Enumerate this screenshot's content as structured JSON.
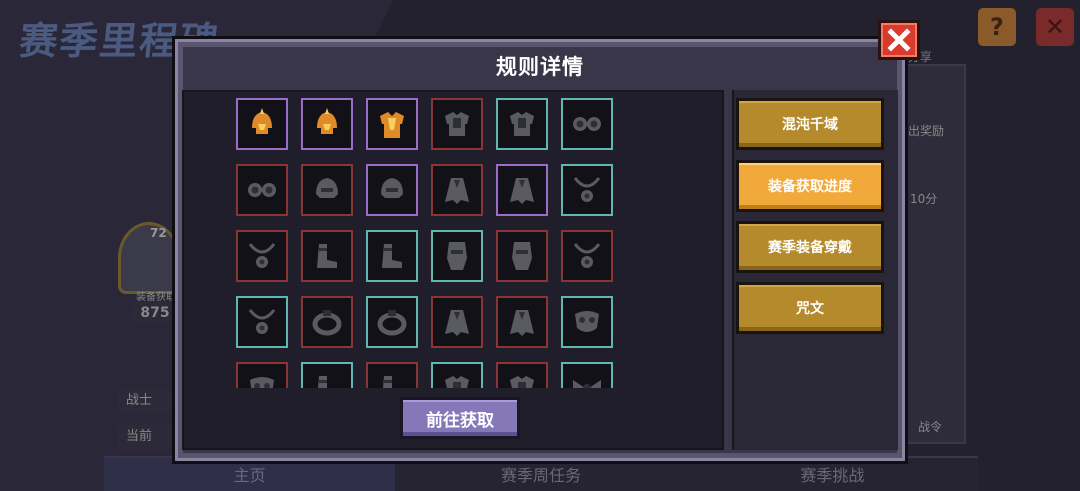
{
  "background": {
    "title": "赛季里程碑",
    "share_label": "分享",
    "side_texts": [
      "出奖励",
      "10分",
      "战令"
    ],
    "left_badge_pct": "72",
    "left_badge_label": "装备获取",
    "left_number": "875",
    "left_rows": [
      "战士",
      "当前"
    ],
    "bottom_tabs": [
      "主页",
      "赛季周任务",
      "赛季挑战"
    ]
  },
  "modal": {
    "title": "规则详情",
    "goto_button": "前往获取",
    "menu": [
      {
        "label": "混沌千域",
        "active": false
      },
      {
        "label": "装备获取进度",
        "active": true
      },
      {
        "label": "赛季装备穿戴",
        "active": false
      },
      {
        "label": "咒文",
        "active": false
      }
    ]
  },
  "slots": [
    {
      "frame": "purple",
      "icon": "helmet-gold-icon",
      "owned": true
    },
    {
      "frame": "purple",
      "icon": "helmet-gold-icon",
      "owned": true
    },
    {
      "frame": "purple",
      "icon": "armor-gold-icon",
      "owned": true
    },
    {
      "frame": "red",
      "icon": "armor-icon",
      "owned": false
    },
    {
      "frame": "cyan",
      "icon": "armor-icon",
      "owned": false
    },
    {
      "frame": "cyan",
      "icon": "goggles-icon",
      "owned": false
    },
    {
      "frame": "red",
      "icon": "goggles-icon",
      "owned": false
    },
    {
      "frame": "red",
      "icon": "helmet-icon",
      "owned": false
    },
    {
      "frame": "purple",
      "icon": "helmet-icon",
      "owned": false
    },
    {
      "frame": "red",
      "icon": "cloak-icon",
      "owned": false
    },
    {
      "frame": "purple",
      "icon": "cloak-icon",
      "owned": false
    },
    {
      "frame": "cyan",
      "icon": "amulet-icon",
      "owned": false
    },
    {
      "frame": "red",
      "icon": "amulet-icon",
      "owned": false
    },
    {
      "frame": "red",
      "icon": "boots-icon",
      "owned": false
    },
    {
      "frame": "cyan",
      "icon": "boots-icon",
      "owned": false
    },
    {
      "frame": "cyan",
      "icon": "gauntlet-icon",
      "owned": false
    },
    {
      "frame": "red",
      "icon": "gauntlet-icon",
      "owned": false
    },
    {
      "frame": "red",
      "icon": "amulet-icon",
      "owned": false
    },
    {
      "frame": "cyan",
      "icon": "amulet-icon",
      "owned": false
    },
    {
      "frame": "red",
      "icon": "ring-icon",
      "owned": false
    },
    {
      "frame": "cyan",
      "icon": "ring-icon",
      "owned": false
    },
    {
      "frame": "red",
      "icon": "cloak-icon",
      "owned": false
    },
    {
      "frame": "red",
      "icon": "cloak-icon",
      "owned": false
    },
    {
      "frame": "cyan",
      "icon": "mask-icon",
      "owned": false
    },
    {
      "frame": "red",
      "icon": "mask-icon",
      "owned": false
    },
    {
      "frame": "cyan",
      "icon": "boots-icon",
      "owned": false
    },
    {
      "frame": "red",
      "icon": "boots-icon",
      "owned": false
    },
    {
      "frame": "cyan",
      "icon": "armor-icon",
      "owned": false
    },
    {
      "frame": "red",
      "icon": "armor-icon",
      "owned": false
    },
    {
      "frame": "cyan",
      "icon": "bow-icon",
      "owned": false
    }
  ],
  "colors": {
    "menu_active": "#f0a93a",
    "menu_default": "#b58a2c",
    "goto_button": "#8478b8",
    "close_button": "#d93a2e"
  }
}
